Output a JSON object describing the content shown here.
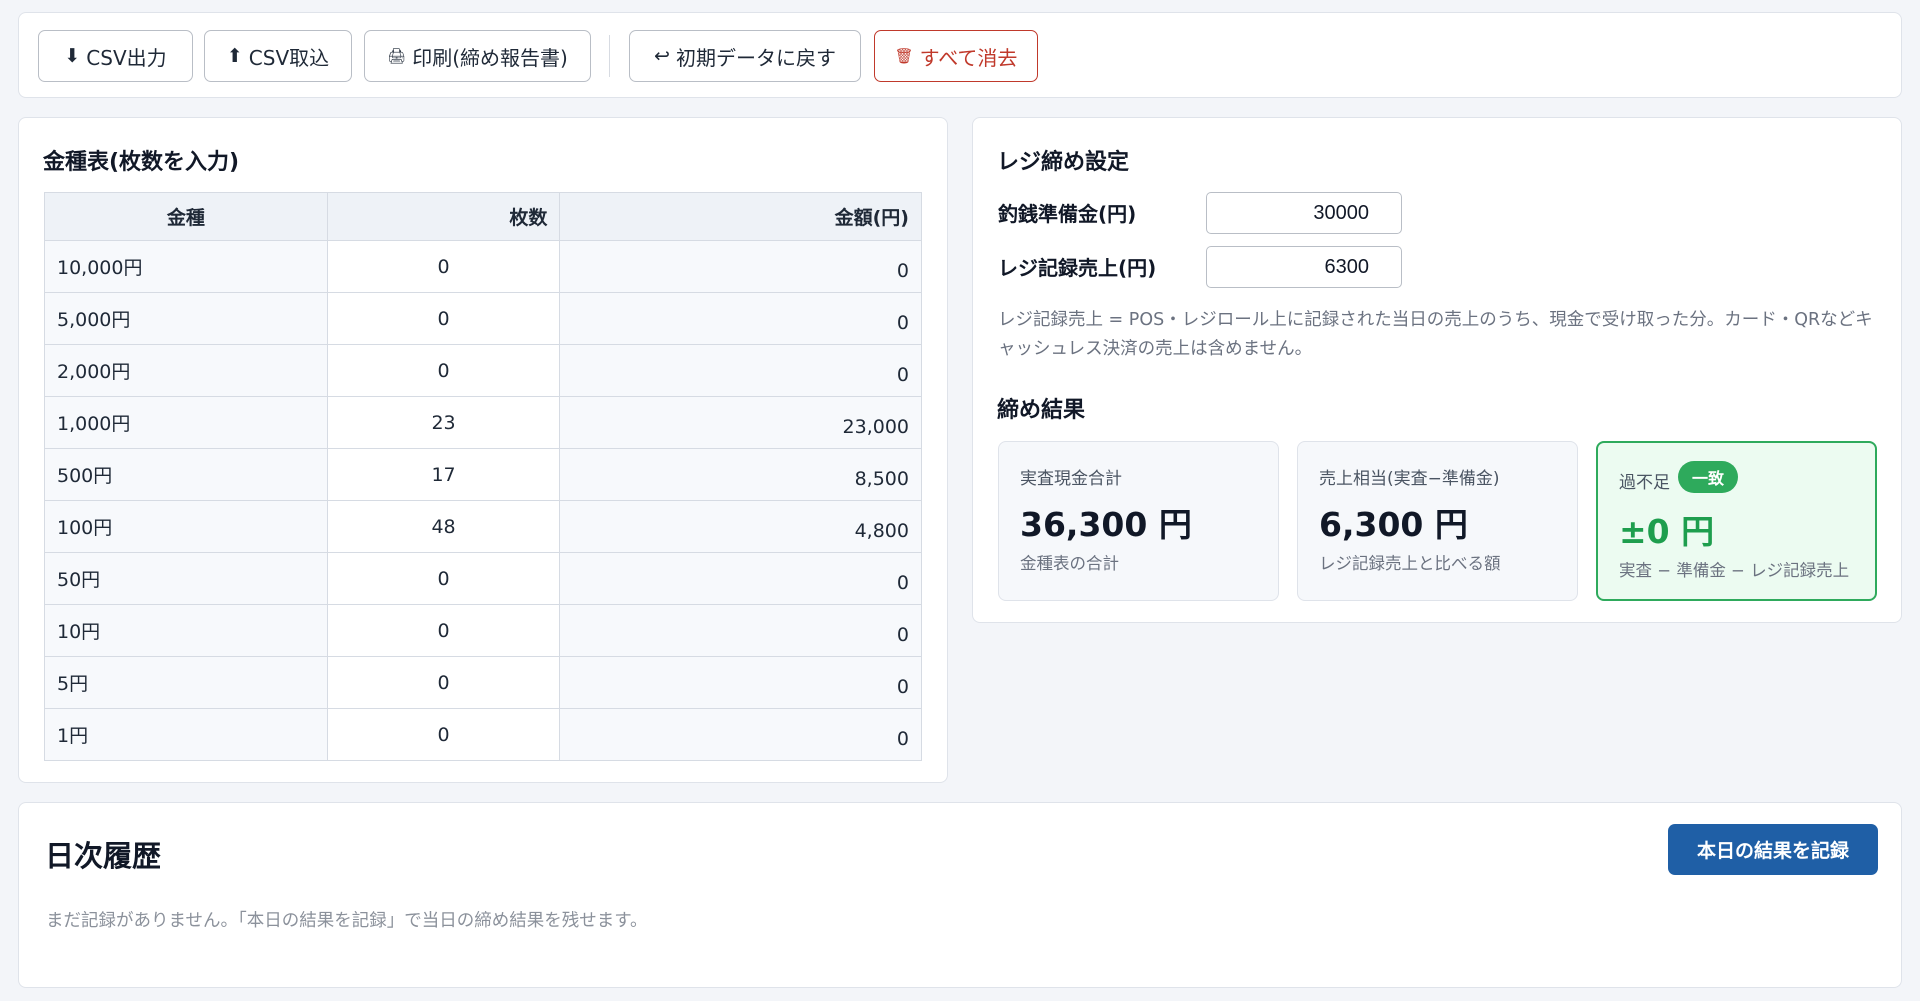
{
  "toolbar": {
    "csv_export": {
      "icon": "⬇",
      "label": "CSV出力"
    },
    "csv_import": {
      "icon": "⬆",
      "label": "CSV取込"
    },
    "print": {
      "icon": "🖨",
      "label": "印刷(締め報告書)"
    },
    "reset": {
      "icon": "↩",
      "label": "初期データに戻す"
    },
    "clear_all": {
      "icon": "🗑",
      "label": "すべて消去"
    }
  },
  "denominations": {
    "title": "金種表(枚数を入力)",
    "headers": {
      "denomination": "金種",
      "count": "枚数",
      "amount": "金額(円)"
    },
    "rows": [
      {
        "label": "10,000円",
        "count": "0",
        "amount": "0"
      },
      {
        "label": "5,000円",
        "count": "0",
        "amount": "0"
      },
      {
        "label": "2,000円",
        "count": "0",
        "amount": "0"
      },
      {
        "label": "1,000円",
        "count": "23",
        "amount": "23,000"
      },
      {
        "label": "500円",
        "count": "17",
        "amount": "8,500"
      },
      {
        "label": "100円",
        "count": "48",
        "amount": "4,800"
      },
      {
        "label": "50円",
        "count": "0",
        "amount": "0"
      },
      {
        "label": "10円",
        "count": "0",
        "amount": "0"
      },
      {
        "label": "5円",
        "count": "0",
        "amount": "0"
      },
      {
        "label": "1円",
        "count": "0",
        "amount": "0"
      }
    ]
  },
  "settings": {
    "title": "レジ締め設定",
    "float_label": "釣銭準備金(円)",
    "float_value": "30000",
    "sales_label": "レジ記録売上(円)",
    "sales_value": "6300",
    "note": "レジ記録売上 = POS・レジロール上に記録された当日の売上のうち、現金で受け取った分。カード・QRなどキャッシュレス決済の売上は含めません。"
  },
  "results": {
    "title": "締め結果",
    "actual_total": {
      "label": "実査現金合計",
      "value": "36,300 円",
      "sub": "金種表の合計"
    },
    "sales_equiv": {
      "label": "売上相当(実査−準備金)",
      "value": "6,300 円",
      "sub": "レジ記録売上と比べる額"
    },
    "difference": {
      "label": "過不足",
      "badge": "一致",
      "value": "±0 円",
      "sub": "実査 − 準備金 − レジ記録売上"
    }
  },
  "history": {
    "title": "日次履歴",
    "record_button": "本日の結果を記録",
    "empty_message": "まだ記録がありません。「本日の結果を記録」で当日の締め結果を残せます。"
  },
  "colors": {
    "accent": "#1f5fa6",
    "success": "#2eaa5c",
    "danger": "#c0392b"
  }
}
